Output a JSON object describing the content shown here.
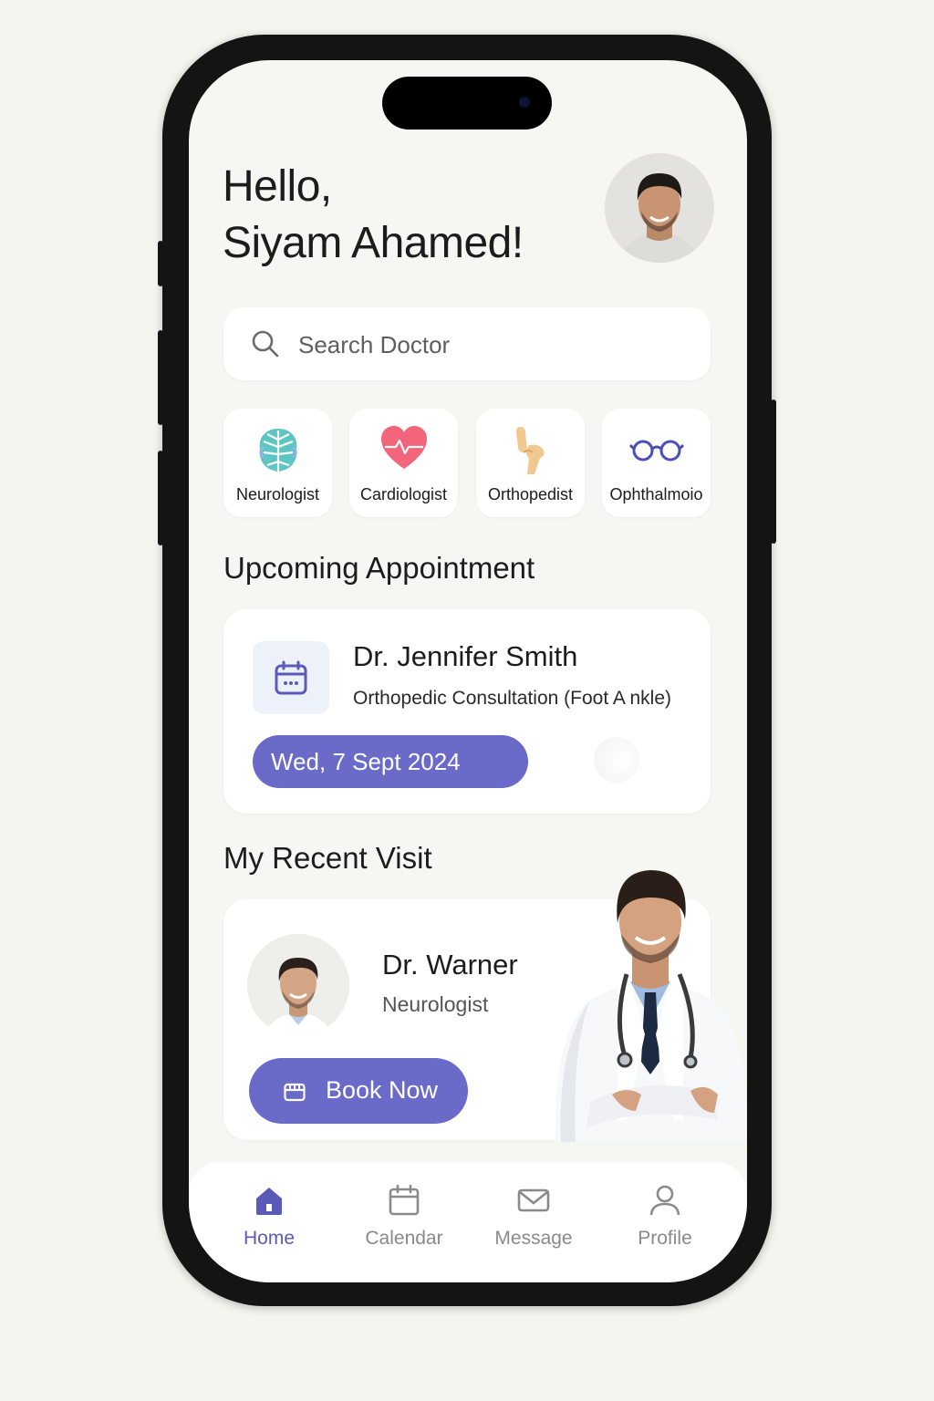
{
  "greeting": {
    "line1": "Hello,",
    "line2": "Siyam Ahamed!"
  },
  "search": {
    "placeholder": "Search Doctor",
    "icon": "search-icon"
  },
  "categories": [
    {
      "label": "Neurologist",
      "icon": "brain-icon",
      "color": "#5ec6c2"
    },
    {
      "label": "Cardiologist",
      "icon": "heart-icon",
      "color": "#f2657a"
    },
    {
      "label": "Orthopedist",
      "icon": "bone-joint-icon",
      "color": "#f0c890"
    },
    {
      "label": "Ophthalmoio",
      "icon": "glasses-icon",
      "color": "#4a4eb8"
    }
  ],
  "upcoming": {
    "title": "Upcoming Appointment",
    "doctor": "Dr. Jennifer Smith",
    "description": "Orthopedic Consultation (Foot A nkle)",
    "date": "Wed, 7 Sept 2024",
    "icon": "calendar-icon"
  },
  "recent": {
    "title": "My Recent Visit",
    "doctor": "Dr. Warner",
    "specialty": "Neurologist",
    "button_label": "Book Now",
    "button_icon": "calendar-icon"
  },
  "tabs": [
    {
      "label": "Home",
      "icon": "home-icon",
      "active": true
    },
    {
      "label": "Calendar",
      "icon": "calendar-icon",
      "active": false
    },
    {
      "label": "Message",
      "icon": "mail-icon",
      "active": false
    },
    {
      "label": "Profile",
      "icon": "user-icon",
      "active": false
    }
  ],
  "colors": {
    "accent": "#6a6bc8",
    "background": "#f6f6f2",
    "card": "#ffffff",
    "text": "#1c1c1c",
    "muted": "#8a8a8a"
  }
}
